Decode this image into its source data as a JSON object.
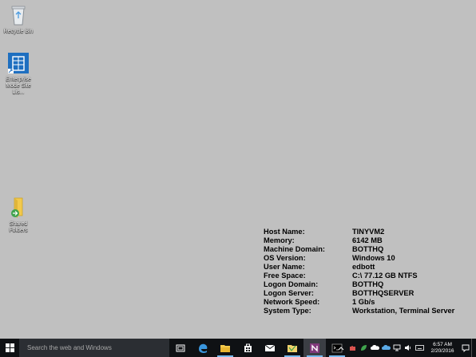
{
  "desktop": {
    "icons": [
      {
        "label": "Recycle Bin"
      },
      {
        "label": "Enterprise\nMode Site Lis..."
      },
      {
        "label": "Shared\nFolders"
      }
    ]
  },
  "bginfo": {
    "rows": [
      {
        "key": "Host Name:",
        "value": "TINYVM2"
      },
      {
        "key": "Memory:",
        "value": "6142 MB"
      },
      {
        "key": "Machine Domain:",
        "value": "BOTTHQ"
      },
      {
        "key": "OS Version:",
        "value": "Windows 10"
      },
      {
        "key": "User Name:",
        "value": "edbott"
      },
      {
        "key": "Free Space:",
        "value": "C:\\ 77.12 GB NTFS"
      },
      {
        "key": "Logon Domain:",
        "value": "BOTTHQ"
      },
      {
        "key": "Logon Server:",
        "value": "BOTTHQSERVER"
      },
      {
        "key": "Network Speed:",
        "value": "1 Gb/s"
      },
      {
        "key": "System Type:",
        "value": "Workstation, Terminal Server"
      }
    ]
  },
  "taskbar": {
    "search_placeholder": "Search the web and Windows",
    "pinned": [
      "task-view",
      "edge",
      "file-explorer",
      "store",
      "mail",
      "folder",
      "onenote",
      "command-prompt"
    ],
    "clock_time": "6:57 AM",
    "clock_date": "2/20/2016"
  },
  "colors": {
    "desktop_bg": "#c0c0c0",
    "taskbar_bg": "#0f1114",
    "accent": "#1e6fc0",
    "onenote": "#80397b"
  }
}
